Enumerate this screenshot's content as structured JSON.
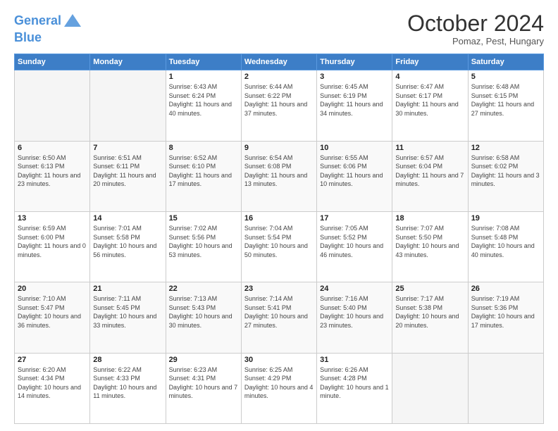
{
  "header": {
    "logo_line1": "General",
    "logo_line2": "Blue",
    "month": "October 2024",
    "location": "Pomaz, Pest, Hungary"
  },
  "weekdays": [
    "Sunday",
    "Monday",
    "Tuesday",
    "Wednesday",
    "Thursday",
    "Friday",
    "Saturday"
  ],
  "weeks": [
    [
      {
        "day": "",
        "info": ""
      },
      {
        "day": "",
        "info": ""
      },
      {
        "day": "1",
        "info": "Sunrise: 6:43 AM\nSunset: 6:24 PM\nDaylight: 11 hours and 40 minutes."
      },
      {
        "day": "2",
        "info": "Sunrise: 6:44 AM\nSunset: 6:22 PM\nDaylight: 11 hours and 37 minutes."
      },
      {
        "day": "3",
        "info": "Sunrise: 6:45 AM\nSunset: 6:19 PM\nDaylight: 11 hours and 34 minutes."
      },
      {
        "day": "4",
        "info": "Sunrise: 6:47 AM\nSunset: 6:17 PM\nDaylight: 11 hours and 30 minutes."
      },
      {
        "day": "5",
        "info": "Sunrise: 6:48 AM\nSunset: 6:15 PM\nDaylight: 11 hours and 27 minutes."
      }
    ],
    [
      {
        "day": "6",
        "info": "Sunrise: 6:50 AM\nSunset: 6:13 PM\nDaylight: 11 hours and 23 minutes."
      },
      {
        "day": "7",
        "info": "Sunrise: 6:51 AM\nSunset: 6:11 PM\nDaylight: 11 hours and 20 minutes."
      },
      {
        "day": "8",
        "info": "Sunrise: 6:52 AM\nSunset: 6:10 PM\nDaylight: 11 hours and 17 minutes."
      },
      {
        "day": "9",
        "info": "Sunrise: 6:54 AM\nSunset: 6:08 PM\nDaylight: 11 hours and 13 minutes."
      },
      {
        "day": "10",
        "info": "Sunrise: 6:55 AM\nSunset: 6:06 PM\nDaylight: 11 hours and 10 minutes."
      },
      {
        "day": "11",
        "info": "Sunrise: 6:57 AM\nSunset: 6:04 PM\nDaylight: 11 hours and 7 minutes."
      },
      {
        "day": "12",
        "info": "Sunrise: 6:58 AM\nSunset: 6:02 PM\nDaylight: 11 hours and 3 minutes."
      }
    ],
    [
      {
        "day": "13",
        "info": "Sunrise: 6:59 AM\nSunset: 6:00 PM\nDaylight: 11 hours and 0 minutes."
      },
      {
        "day": "14",
        "info": "Sunrise: 7:01 AM\nSunset: 5:58 PM\nDaylight: 10 hours and 56 minutes."
      },
      {
        "day": "15",
        "info": "Sunrise: 7:02 AM\nSunset: 5:56 PM\nDaylight: 10 hours and 53 minutes."
      },
      {
        "day": "16",
        "info": "Sunrise: 7:04 AM\nSunset: 5:54 PM\nDaylight: 10 hours and 50 minutes."
      },
      {
        "day": "17",
        "info": "Sunrise: 7:05 AM\nSunset: 5:52 PM\nDaylight: 10 hours and 46 minutes."
      },
      {
        "day": "18",
        "info": "Sunrise: 7:07 AM\nSunset: 5:50 PM\nDaylight: 10 hours and 43 minutes."
      },
      {
        "day": "19",
        "info": "Sunrise: 7:08 AM\nSunset: 5:48 PM\nDaylight: 10 hours and 40 minutes."
      }
    ],
    [
      {
        "day": "20",
        "info": "Sunrise: 7:10 AM\nSunset: 5:47 PM\nDaylight: 10 hours and 36 minutes."
      },
      {
        "day": "21",
        "info": "Sunrise: 7:11 AM\nSunset: 5:45 PM\nDaylight: 10 hours and 33 minutes."
      },
      {
        "day": "22",
        "info": "Sunrise: 7:13 AM\nSunset: 5:43 PM\nDaylight: 10 hours and 30 minutes."
      },
      {
        "day": "23",
        "info": "Sunrise: 7:14 AM\nSunset: 5:41 PM\nDaylight: 10 hours and 27 minutes."
      },
      {
        "day": "24",
        "info": "Sunrise: 7:16 AM\nSunset: 5:40 PM\nDaylight: 10 hours and 23 minutes."
      },
      {
        "day": "25",
        "info": "Sunrise: 7:17 AM\nSunset: 5:38 PM\nDaylight: 10 hours and 20 minutes."
      },
      {
        "day": "26",
        "info": "Sunrise: 7:19 AM\nSunset: 5:36 PM\nDaylight: 10 hours and 17 minutes."
      }
    ],
    [
      {
        "day": "27",
        "info": "Sunrise: 6:20 AM\nSunset: 4:34 PM\nDaylight: 10 hours and 14 minutes."
      },
      {
        "day": "28",
        "info": "Sunrise: 6:22 AM\nSunset: 4:33 PM\nDaylight: 10 hours and 11 minutes."
      },
      {
        "day": "29",
        "info": "Sunrise: 6:23 AM\nSunset: 4:31 PM\nDaylight: 10 hours and 7 minutes."
      },
      {
        "day": "30",
        "info": "Sunrise: 6:25 AM\nSunset: 4:29 PM\nDaylight: 10 hours and 4 minutes."
      },
      {
        "day": "31",
        "info": "Sunrise: 6:26 AM\nSunset: 4:28 PM\nDaylight: 10 hours and 1 minute."
      },
      {
        "day": "",
        "info": ""
      },
      {
        "day": "",
        "info": ""
      }
    ]
  ]
}
